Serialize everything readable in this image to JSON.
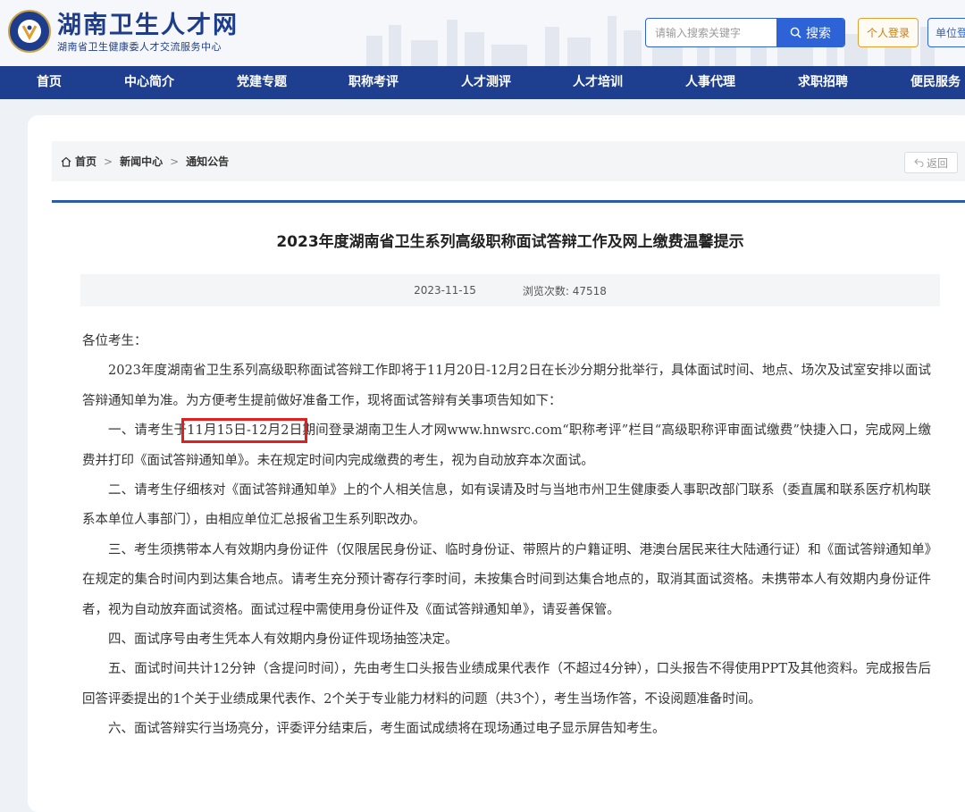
{
  "header": {
    "logo_title": "湖南卫生人才网",
    "logo_subtitle": "湖南省卫生健康委人才交流服务中心",
    "search_placeholder": "请输入搜索关键字",
    "search_button": "搜索",
    "login_button": "个人登录",
    "org_login_button": "单位登"
  },
  "nav": {
    "items": [
      "首页",
      "中心简介",
      "党建专题",
      "职称考评",
      "人才测评",
      "人才培训",
      "人事代理",
      "求职招聘",
      "便民服务"
    ]
  },
  "breadcrumb": {
    "home": "首页",
    "level2": "新闻中心",
    "level3": "通知公告",
    "separator": ">",
    "back": "返回"
  },
  "article": {
    "title": "2023年度湖南省卫生系列高级职称面试答辩工作及网上缴费温馨提示",
    "date": "2023-11-15",
    "views_label": "浏览次数:",
    "views": "47518",
    "greeting": "各位考生：",
    "p1": "2023年度湖南省卫生系列高级职称面试答辩工作即将于11月20日-12月2日在长沙分期分批举行，具体面试时间、地点、场次及试室安排以面试答辩通知单为准。为方便考生提前做好准备工作，现将面试答辩有关事项告知如下：",
    "p2_pre": "一、请考生于",
    "p2_highlight": "11月15日-12月2日",
    "p2_post": "期间登录湖南卫生人才网www.hnwsrc.com“职称考评”栏目“高级职称评审面试缴费”快捷入口，完成网上缴费并打印《面试答辩通知单》。未在规定时间内完成缴费的考生，视为自动放弃本次面试。",
    "p3": "二、请考生仔细核对《面试答辩通知单》上的个人相关信息，如有误请及时与当地市州卫生健康委人事职改部门联系（委直属和联系医疗机构联系本单位人事部门），由相应单位汇总报省卫生系列职改办。",
    "p4": "三、考生须携带本人有效期内身份证件（仅限居民身份证、临时身份证、带照片的户籍证明、港澳台居民来往大陆通行证）和《面试答辩通知单》在规定的集合时间内到达集合地点。请考生充分预计寄存行李时间，未按集合时间到达集合地点的，取消其面试资格。未携带本人有效期内身份证件者，视为自动放弃面试资格。面试过程中需使用身份证件及《面试答辩通知单》，请妥善保管。",
    "p5": "四、面试序号由考生凭本人有效期内身份证件现场抽签决定。",
    "p6": "五、面试时间共计12分钟（含提问时间），先由考生口头报告业绩成果代表作（不超过4分钟），口头报告不得使用PPT及其他资料。完成报告后回答评委提出的1个关于业绩成果代表作、2个关于专业能力材料的问题（共3个），考生当场作答，不设阅题准备时间。",
    "p7": "六、面试答辩实行当场亮分，评委评分结束后，考生面试成绩将在现场通过电子显示屏告知考生。"
  },
  "colors": {
    "brand_blue": "#1e3f8f",
    "accent_blue": "#2d63d6",
    "login_orange": "#e0a030",
    "highlight_red": "#e02020"
  }
}
